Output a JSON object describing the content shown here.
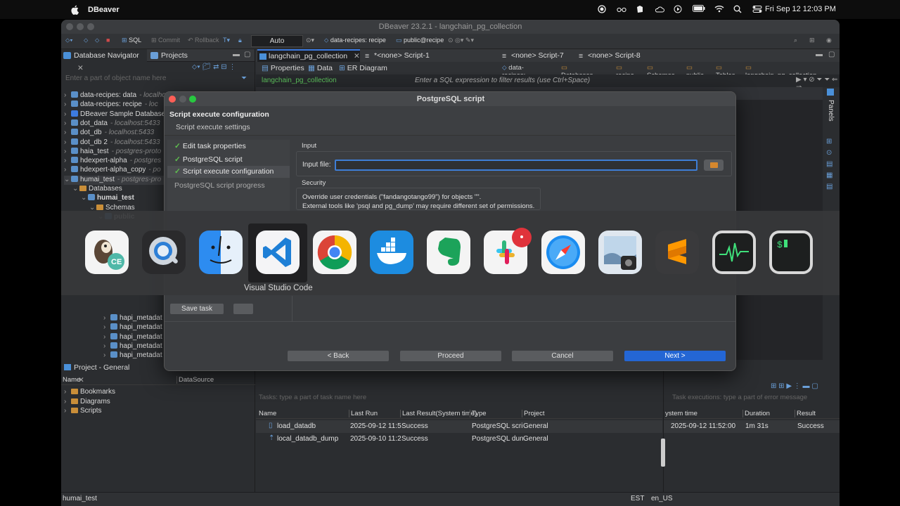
{
  "menubar": {
    "app_name": "DBeaver",
    "clock": "Fri Sep 12  12:03 PM"
  },
  "window": {
    "title": "DBeaver 23.2.1 - langchain_pg_collection"
  },
  "toolbar": {
    "sql_label": "SQL",
    "commit_label": "Commit",
    "rollback_label": "Rollback",
    "auto_label": "Auto",
    "datasource_label": "data-recipes: recipe",
    "schema_label": "public@recipe"
  },
  "navigator": {
    "tab_db_nav": "Database Navigator",
    "tab_projects": "Projects",
    "filter_placeholder": "Enter a part of object name here",
    "items": [
      {
        "name": "data-recipes: data",
        "conn": "- localhost:5433",
        "type": "conn"
      },
      {
        "name": "data-recipes: recipe",
        "conn": "- loc",
        "type": "conn"
      },
      {
        "name": "DBeaver Sample Database",
        "conn": "",
        "type": "sample"
      },
      {
        "name": "dot_data",
        "conn": "- localhost:5433",
        "type": "conn"
      },
      {
        "name": "dot_db",
        "conn": "- localhost:5433",
        "type": "conn"
      },
      {
        "name": "dot_db 2",
        "conn": "- localhost:5433",
        "type": "conn"
      },
      {
        "name": "haia_test",
        "conn": "- postgres-proto",
        "type": "conn"
      },
      {
        "name": "hdexpert-alpha",
        "conn": "- postgres",
        "type": "conn"
      },
      {
        "name": "hdexpert-alpha_copy",
        "conn": "- po",
        "type": "conn"
      },
      {
        "name": "humai_test",
        "conn": "- postgres-pro",
        "type": "conn"
      }
    ],
    "sub_databases": "Databases",
    "sub_humai": "humai_test",
    "sub_schemas": "Schemas",
    "sub_public": "public",
    "hapi_items": [
      "hapi_metadat",
      "hapi_metadat",
      "hapi_metadat",
      "hapi_metadat",
      "hapi_metadat",
      "hapi_metadat",
      "hapi_metadat"
    ]
  },
  "editor": {
    "tabs": [
      "langchain_pg_collection",
      "*<none> Script-1",
      "<none> Script-7",
      "<none> Script-8"
    ],
    "subtabs": [
      "Properties",
      "Data",
      "ER Diagram"
    ],
    "crumbs": [
      "data-recipes: recipe",
      "Databases",
      "recipe",
      "Schemas",
      "public",
      "Tables",
      "langchain_pg_collection"
    ],
    "filter_table": "langchain_pg_collection",
    "filter_placeholder": "Enter a SQL expression to filter results (use Ctrl+Space)",
    "panels_label": "Panels"
  },
  "dialog": {
    "title": "PostgreSQL script",
    "header_title": "Script execute configuration",
    "header_sub": "Script execute settings",
    "steps": [
      {
        "label": "Edit task properties",
        "done": true
      },
      {
        "label": "PostgreSQL script",
        "done": true
      },
      {
        "label": "Script execute configuration",
        "done": true
      },
      {
        "label": "PostgreSQL script progress",
        "done": false
      }
    ],
    "input_group": "Input",
    "input_file_label": "Input file:",
    "input_file_value": "",
    "security_group": "Security",
    "security_line1": "Override user credentials (\"fandangotango99\") for objects \"\".",
    "security_line2": "External tools like 'psql and pg_dump' may require different set of permissions.",
    "save_task": "Save task",
    "back": "< Back",
    "proceed": "Proceed",
    "cancel": "Cancel",
    "next": "Next >"
  },
  "dock": {
    "apps": [
      "dbeaver-icon",
      "quicktime-icon",
      "finder-icon",
      "vscode-icon",
      "chrome-icon",
      "docker-icon",
      "evernote-icon",
      "slack-icon",
      "safari-icon",
      "preview-icon",
      "sublime-icon",
      "activity-monitor-icon",
      "terminal-icon"
    ],
    "hover_label": "Visual Studio Code"
  },
  "project": {
    "tab": "Project - General",
    "col_name": "Name",
    "col_datasource": "DataSource",
    "items": [
      "Bookmarks",
      "Diagrams",
      "Scripts"
    ]
  },
  "tasks": {
    "filter_placeholder": "Tasks: type a part of task name here",
    "columns": [
      "Name",
      "Last Run",
      "Last Result(System time)",
      "Type",
      "Project"
    ],
    "rows": [
      {
        "name": "load_datadb",
        "last_run": "2025-09-12 11:5",
        "result": "Success",
        "type": "PostgreSQL scri",
        "project": "General"
      },
      {
        "name": "local_datadb_dump",
        "last_run": "2025-09-10 11:2",
        "result": "Success",
        "type": "PostgreSQL dun",
        "project": "General"
      }
    ]
  },
  "executions": {
    "filter_placeholder": "Task executions: type a part of error message",
    "columns": [
      "ystem time",
      "Duration",
      "Result"
    ],
    "rows": [
      {
        "time": "2025-09-12 11:52:00",
        "duration": "1m 31s",
        "result": "Success"
      }
    ]
  },
  "status": {
    "left": "humai_test",
    "tz": "EST",
    "locale": "en_US"
  }
}
